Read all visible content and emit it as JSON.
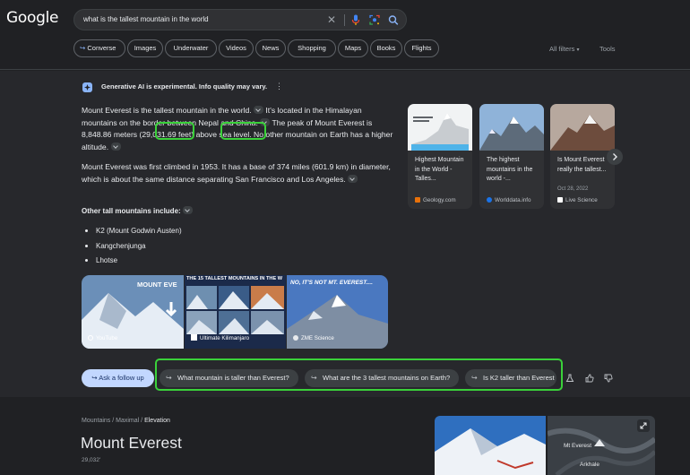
{
  "header": {
    "logo": "Google",
    "search_query": "what is the tallest mountain in the world",
    "clear_symbol": "✕"
  },
  "tabs": [
    "Converse",
    "Images",
    "Underwater",
    "Videos",
    "News",
    "Shopping",
    "Maps",
    "Books",
    "Flights"
  ],
  "tools": {
    "all_filters": "All filters",
    "tools": "Tools"
  },
  "ai": {
    "notice": "Generative AI is experimental. Info quality may vary.",
    "p1_a": "Mount Everest is the tallest mountain in the world.",
    "p1_b": "It's located in the Himalayan mountains on the border between Nepal and China.",
    "p1_c": "The peak of Mount Everest is ",
    "p1_meters": "8,848.86",
    "p1_d": " meters ",
    "p1_feet": "(29,031.69",
    "p1_e": " feet) above sea level. No other mountain on Earth has a higher altitude.",
    "p2": "Mount Everest was first climbed in 1953. It has a base of 374 miles (601.9 km) in diameter, which is about the same distance separating San Francisco and Los Angeles.",
    "list_heading": "Other tall mountains include:",
    "list": [
      "K2 (Mount Godwin Austen)",
      "Kangchenjunga",
      "Lhotse"
    ]
  },
  "cards": [
    {
      "title": "Highest Mountain in the World - Talles...",
      "source": "Geology.com",
      "date": "",
      "fav_color": "#e8710a"
    },
    {
      "title": "The highest mountains in the world -...",
      "source": "Worlddata.info",
      "date": "",
      "fav_color": "#1a73e8"
    },
    {
      "title": "Is Mount Everest really the tallest...",
      "source": "Live Science",
      "date": "Oct 28, 2022",
      "fav_color": "#ffffff"
    }
  ],
  "videos": [
    {
      "overlay": "MOUNT EVE",
      "source": "YouTube"
    },
    {
      "overlay": "THE 15 TALLEST MOUNTAINS IN THE W",
      "source": "Ultimate Kilimanjaro"
    },
    {
      "overlay": "NO, IT'S NOT MT. EVEREST....",
      "source": "ZME Science"
    }
  ],
  "followups": {
    "ask": "Ask a follow up",
    "suggestions": [
      "What mountain is taller than Everest?",
      "What are the 3 tallest mountains on Earth?",
      "Is K2 taller than Everest"
    ]
  },
  "knowledge_panel": {
    "crumb_1": "Mountains",
    "crumb_sep": "/",
    "crumb_2": "Maximal",
    "crumb_3": "Elevation",
    "title": "Mount Everest",
    "subtitle": "29,032'",
    "map_label_1": "Mt Everest",
    "map_label_2": "Arkhale"
  },
  "colors": {
    "highlight": "#3ad13a",
    "follow_up": "#c2d7ff"
  }
}
